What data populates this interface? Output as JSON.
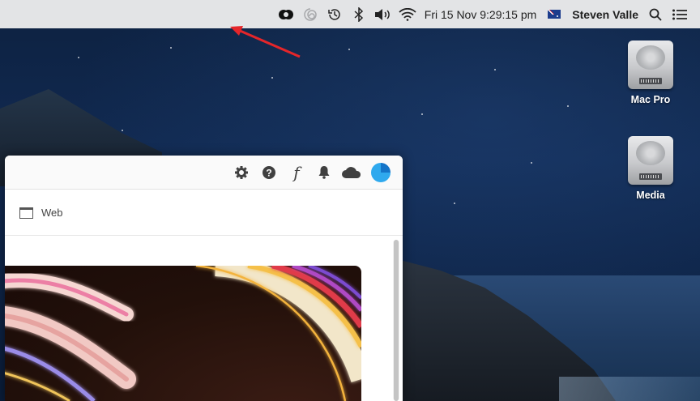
{
  "menubar": {
    "icons": [
      "creative-cloud-icon",
      "spiral-icon",
      "time-machine-icon",
      "bluetooth-icon",
      "volume-icon",
      "wifi-icon"
    ],
    "datetime": "Fri 15 Nov  9:29:15 pm",
    "input_flag": "australia-flag-icon",
    "user_name": "Steven Valle",
    "search_icon": "search-icon",
    "list_icon": "list-icon"
  },
  "desktop": {
    "drives": [
      {
        "label": "Mac Pro"
      },
      {
        "label": "Media"
      }
    ]
  },
  "app_window": {
    "toolbar_icons": [
      "gear-icon",
      "help-icon",
      "fonts-icon",
      "bell-icon",
      "cloud-icon",
      "avatar"
    ],
    "font_glyph": "f",
    "section_tab": "Web"
  },
  "colors": {
    "menubar_bg": "#e3e4e6",
    "annotation_arrow": "#e5262a",
    "avatar_accent": "#2fa9ee"
  }
}
